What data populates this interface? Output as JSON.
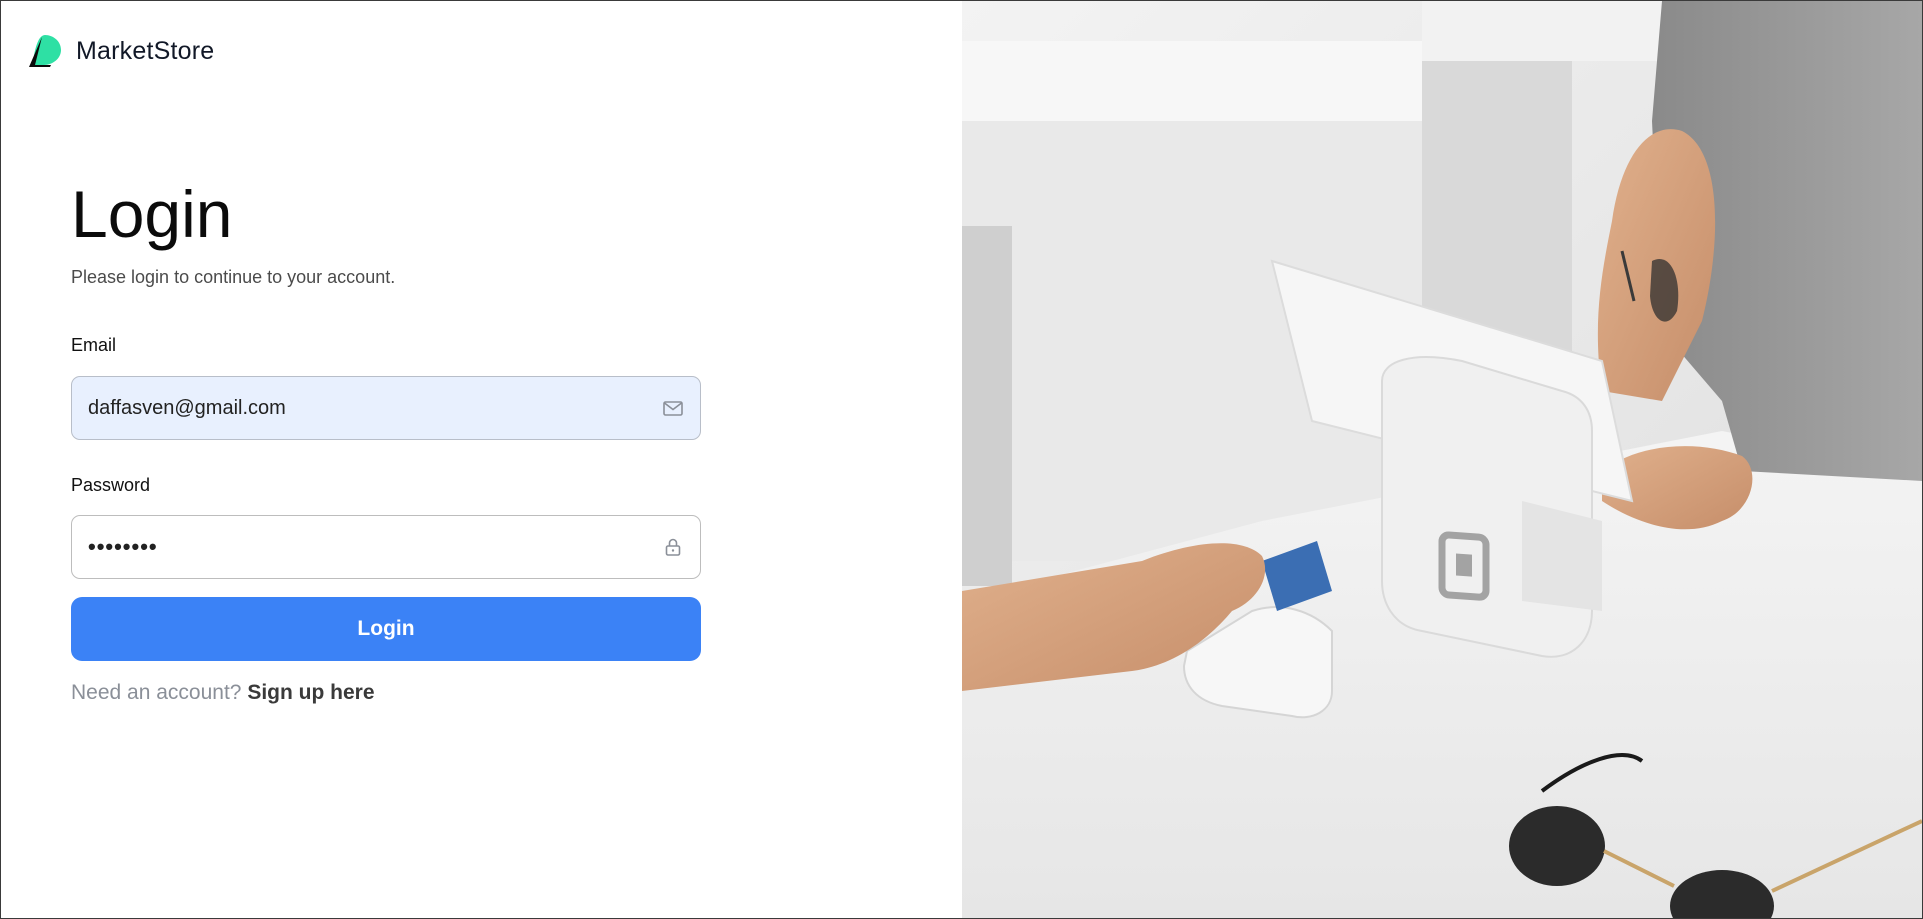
{
  "brand": {
    "name": "MarketStore",
    "icon": "leaf-logo-icon"
  },
  "login": {
    "title": "Login",
    "subtitle": "Please login to continue to your account.",
    "email_label": "Email",
    "email_value": "daffasven@gmail.com",
    "email_icon": "mail-icon",
    "password_label": "Password",
    "password_value": "••••••••",
    "password_icon": "lock-icon",
    "button_label": "Login",
    "signup_prompt": "Need an account?",
    "signup_link": "Sign up here"
  },
  "hero": {
    "image": "point-of-sale-card-payment-photo"
  },
  "colors": {
    "accent": "#3b82f6",
    "logo_green": "#2ee0a4",
    "email_bg": "#e8f0fe"
  }
}
